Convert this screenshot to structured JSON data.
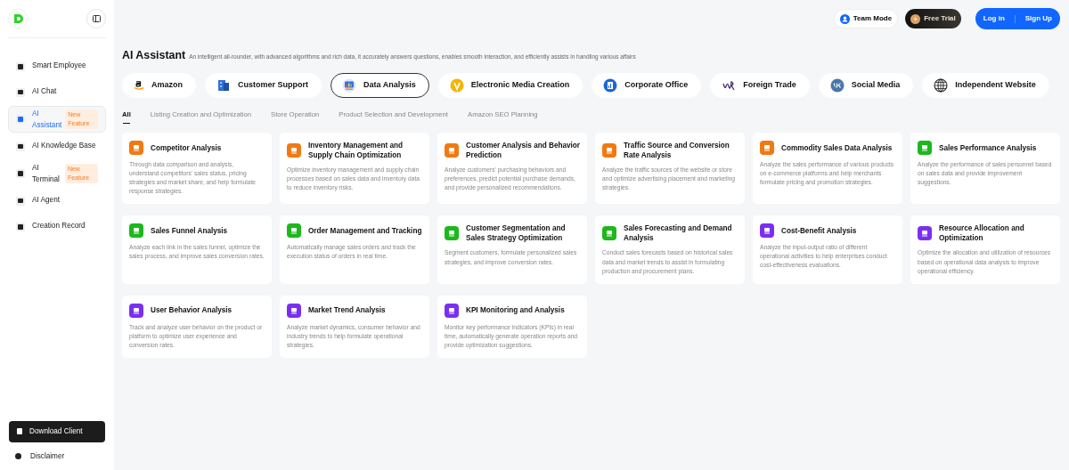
{
  "sidebar": {
    "items": [
      {
        "label": "Smart Employee",
        "selected": false
      },
      {
        "label": "AI Chat",
        "selected": false
      },
      {
        "label": "AI Assistant",
        "selected": true,
        "badge": "New Feature"
      },
      {
        "label": "AI Knowledge Base",
        "selected": false
      },
      {
        "label": "AI Terminal",
        "selected": false,
        "badge": "New Feature"
      },
      {
        "label": "AI Agent",
        "selected": false
      },
      {
        "label": "Creation Record",
        "selected": false
      }
    ],
    "download_button": "Download Client",
    "disclaimer": "Disclaimer"
  },
  "header": {
    "team_mode": "Team Mode",
    "free_trial": "Free Trial",
    "login": "Log in",
    "signup": "Sign Up"
  },
  "page": {
    "title": "AI Assistant",
    "subtitle": "An intelligent all-rounder, with advanced algorithms and rich data, it accurately answers questions, enables smooth interaction, and efficiently assists in handling various affairs"
  },
  "categories": [
    {
      "label": "Amazon",
      "selected": false
    },
    {
      "label": "Customer Support",
      "selected": false
    },
    {
      "label": "Data Analysis",
      "selected": true
    },
    {
      "label": "Electronic Media Creation",
      "selected": false
    },
    {
      "label": "Corporate Office",
      "selected": false
    },
    {
      "label": "Foreign Trade",
      "selected": false
    },
    {
      "label": "Social Media",
      "selected": false
    },
    {
      "label": "Independent Website",
      "selected": false
    }
  ],
  "tabs": [
    {
      "label": "All",
      "selected": true
    },
    {
      "label": "Listing Creation and Optimization",
      "selected": false
    },
    {
      "label": "Store Operation",
      "selected": false
    },
    {
      "label": "Product Selection and Development",
      "selected": false
    },
    {
      "label": "Amazon SEO Planning",
      "selected": false
    }
  ],
  "cards": [
    {
      "title": "Competitor Analysis",
      "description": "Through data comparison and analysis, understand competitors' sales status, pricing strategies and market share, and help formulate response strategies.",
      "color": "#f07a12"
    },
    {
      "title": "Inventory Management and Supply Chain Optimization",
      "description": "Optimize inventory management and supply chain processes based on sales data and inventory data to reduce inventory risks.",
      "color": "#f07a12"
    },
    {
      "title": "Customer Analysis and Behavior Prediction",
      "description": "Analyze customers' purchasing behaviors and preferences, predict potential purchase demands, and provide personalized recommendations.",
      "color": "#f07a12"
    },
    {
      "title": "Traffic Source and Conversion Rate Analysis",
      "description": "Analyze the traffic sources of the website or store and optimize advertising placement and marketing strategies.",
      "color": "#f07a12"
    },
    {
      "title": "Commodity Sales Data Analysis",
      "description": "Analyze the sales performance of various products on e-commerce platforms and help merchants formulate pricing and promotion strategies.",
      "color": "#f07a12"
    },
    {
      "title": "Sales Performance Analysis",
      "description": "Analyze the performance of sales personnel based on sales data and provide improvement suggestions.",
      "color": "#1cb81c"
    },
    {
      "title": "Sales Funnel Analysis",
      "description": "Analyze each link in the sales funnel, optimize the sales process, and improve sales conversion rates.",
      "color": "#1cb81c"
    },
    {
      "title": "Order Management and Tracking",
      "description": "Automatically manage sales orders and track the execution status of orders in real time.",
      "color": "#1cb81c"
    },
    {
      "title": "Customer Segmentation and Sales Strategy Optimization",
      "description": "Segment customers, formulate personalized sales strategies, and improve conversion rates.",
      "color": "#1cb81c"
    },
    {
      "title": "Sales Forecasting and Demand Analysis",
      "description": "Conduct sales forecasts based on historical sales data and market trends to assist in formulating production and procurement plans.",
      "color": "#1cb81c"
    },
    {
      "title": "Cost-Benefit Analysis",
      "description": "Analyze the input-output ratio of different operational activities to help enterprises conduct cost-effectiveness evaluations.",
      "color": "#7a2ff0"
    },
    {
      "title": "Resource Allocation and Optimization",
      "description": "Optimize the allocation and utilization of resources based on operational data analysis to improve operational efficiency.",
      "color": "#7a2ff0"
    },
    {
      "title": "User Behavior Analysis",
      "description": "Track and analyze user behavior on the product or platform to optimize user experience and conversion rates.",
      "color": "#7a2ff0"
    },
    {
      "title": "Market Trend Analysis",
      "description": "Analyze market dynamics, consumer behavior and industry trends to help formulate operational strategies.",
      "color": "#7a2ff0"
    },
    {
      "title": "KPI Monitoring and Analysis",
      "description": "Monitor key performance indicators (KPIs) in real time, automatically generate operation reports and provide optimization suggestions.",
      "color": "#7a2ff0"
    }
  ]
}
